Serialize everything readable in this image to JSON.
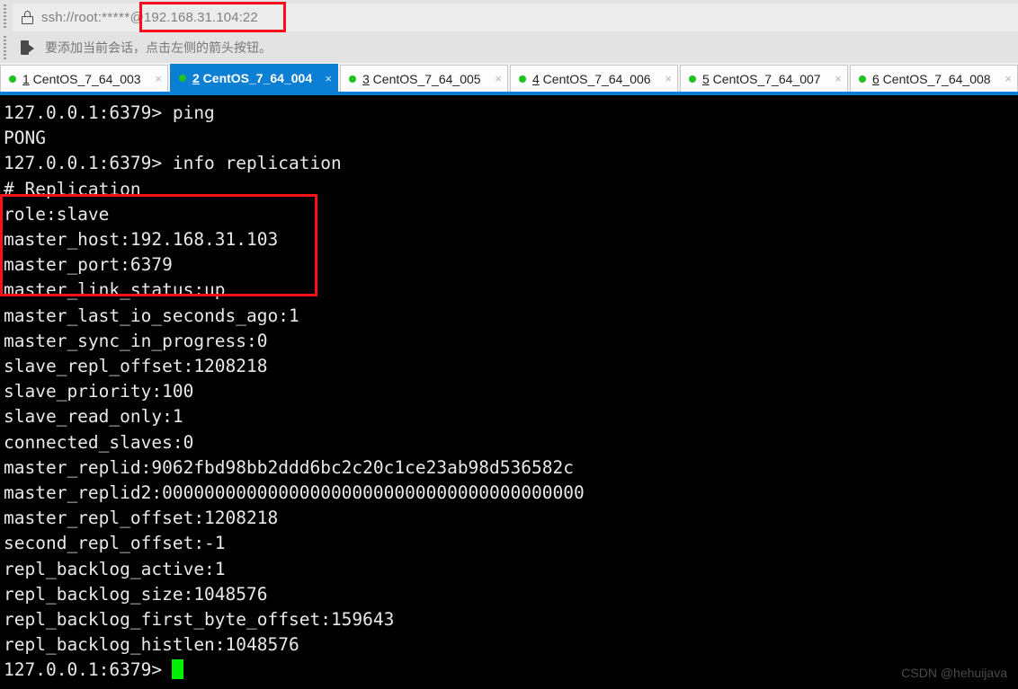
{
  "toolbar": {
    "lock_icon": "lock-icon",
    "address_prefix": "ssh://root:",
    "address_masked": "*****",
    "address_highlighted": "@192.168.31.104:22",
    "session_icon": "session-arrow-icon",
    "hint_text": "要添加当前会话，点击左侧的箭头按钮。",
    "highlight_color": "#fc0d1b"
  },
  "tabs": [
    {
      "num": "1",
      "name": " CentOS_7_64_003",
      "dot_color": "#1fc21f",
      "close": "×",
      "active": false
    },
    {
      "num": "2",
      "name": " CentOS_7_64_004",
      "dot_color": "#1fc21f",
      "close": "×",
      "active": true
    },
    {
      "num": "3",
      "name": " CentOS_7_64_005",
      "dot_color": "#1fc21f",
      "close": "×",
      "active": false
    },
    {
      "num": "4",
      "name": " CentOS_7_64_006",
      "dot_color": "#1fc21f",
      "close": "×",
      "active": false
    },
    {
      "num": "5",
      "name": " CentOS_7_64_007",
      "dot_color": "#1fc21f",
      "close": "×",
      "active": false
    },
    {
      "num": "6",
      "name": " CentOS_7_64_008",
      "dot_color": "#1fc21f",
      "close": "×",
      "active": false
    }
  ],
  "terminal": {
    "accent_color": "#0a7fd4",
    "background": "#000000",
    "foreground": "#e9e9e9",
    "cursor_color": "#00f000",
    "highlight_color": "#fd1018",
    "lines": [
      "127.0.0.1:6379> ping",
      "PONG",
      "127.0.0.1:6379> info replication",
      "# Replication",
      "role:slave",
      "master_host:192.168.31.103",
      "master_port:6379",
      "master_link_status:up",
      "master_last_io_seconds_ago:1",
      "master_sync_in_progress:0",
      "slave_repl_offset:1208218",
      "slave_priority:100",
      "slave_read_only:1",
      "connected_slaves:0",
      "master_replid:9062fbd98bb2ddd6bc2c20c1ce23ab98d536582c",
      "master_replid2:0000000000000000000000000000000000000000",
      "master_repl_offset:1208218",
      "second_repl_offset:-1",
      "repl_backlog_active:1",
      "repl_backlog_size:1048576",
      "repl_backlog_first_byte_offset:159643",
      "repl_backlog_histlen:1048576"
    ],
    "prompt": "127.0.0.1:6379>"
  },
  "watermark": "CSDN @hehuijava"
}
